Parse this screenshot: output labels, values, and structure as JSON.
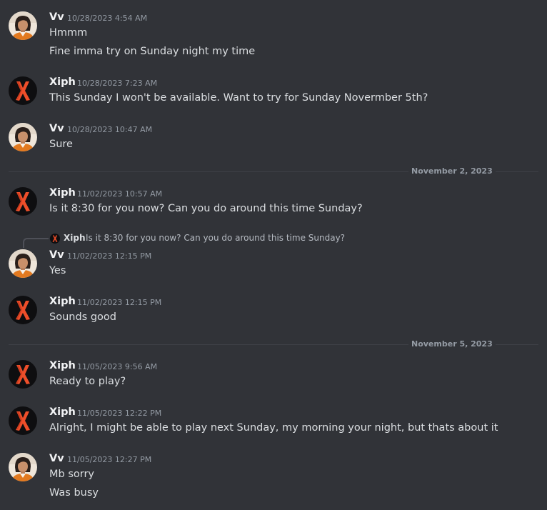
{
  "users": {
    "vv": {
      "name": "Vv",
      "avatar_icon": "woman-portrait-avatar"
    },
    "xiph": {
      "name": "Xiph",
      "avatar_icon": "red-x-avatar"
    }
  },
  "colors": {
    "background": "#313338",
    "username": "#f2f3f5",
    "timestamp": "#949ba4",
    "text": "#dbdee1",
    "xiph_avatar_red": "#ed4e2a"
  },
  "messages": [
    {
      "author": "Vv",
      "timestamp": "10/28/2023 4:54 AM",
      "lines": [
        "Hmmm",
        "Fine imma try on Sunday night my time"
      ]
    },
    {
      "author": "Xiph",
      "timestamp": "10/28/2023 7:23 AM",
      "lines": [
        "This Sunday I won't be available. Want to try for Sunday Novermber 5th?"
      ]
    },
    {
      "author": "Vv",
      "timestamp": "10/28/2023 10:47 AM",
      "lines": [
        "Sure"
      ]
    },
    {
      "author": "Xiph",
      "timestamp": "11/02/2023 10:57 AM",
      "lines": [
        "Is it 8:30 for you now? Can you do around this time Sunday?"
      ]
    },
    {
      "author": "Vv",
      "timestamp": "11/02/2023 12:15 PM",
      "lines": [
        "Yes"
      ]
    },
    {
      "author": "Xiph",
      "timestamp": "11/02/2023 12:15 PM",
      "lines": [
        "Sounds good"
      ]
    },
    {
      "author": "Xiph",
      "timestamp": "11/05/2023 9:56 AM",
      "lines": [
        "Ready to play?"
      ]
    },
    {
      "author": "Xiph",
      "timestamp": "11/05/2023 12:22 PM",
      "lines": [
        "Alright, I might be able to play next Sunday, my morning your night, but thats about it"
      ]
    },
    {
      "author": "Vv",
      "timestamp": "11/05/2023 12:27 PM",
      "lines": [
        "Mb sorry",
        "Was busy"
      ]
    }
  ],
  "dividers": [
    "November 2, 2023",
    "November 5, 2023"
  ],
  "reply": {
    "author": "Xiph",
    "text": "Is it 8:30 for you now? Can you do around this time Sunday?"
  }
}
